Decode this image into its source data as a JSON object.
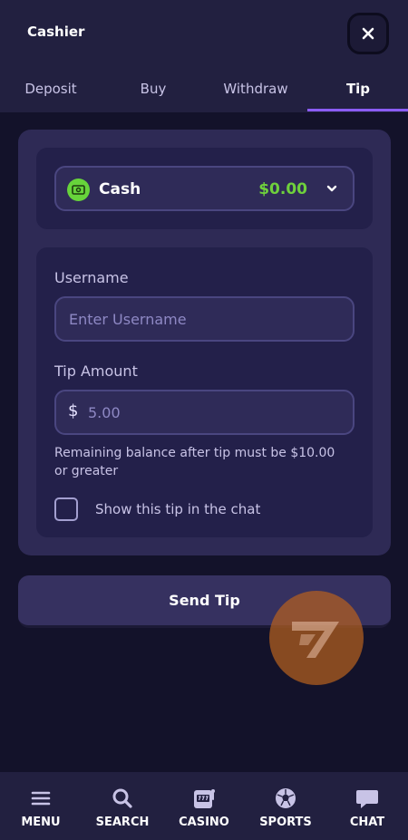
{
  "header": {
    "title": "Cashier"
  },
  "tabs": [
    {
      "label": "Deposit"
    },
    {
      "label": "Buy"
    },
    {
      "label": "Withdraw"
    },
    {
      "label": "Tip",
      "active": true
    }
  ],
  "wallet": {
    "currency": "Cash",
    "balance": "$0.00"
  },
  "form": {
    "username_label": "Username",
    "username_placeholder": "Enter Username",
    "amount_label": "Tip Amount",
    "currency_symbol": "$",
    "amount_placeholder": "5.00",
    "note": "Remaining balance after tip must be $10.00 or greater",
    "show_in_chat_label": "Show this tip in the chat",
    "show_in_chat_checked": false
  },
  "send_button": {
    "label": "Send Tip"
  },
  "bottom_nav": [
    {
      "label": "MENU",
      "icon": "menu-icon"
    },
    {
      "label": "SEARCH",
      "icon": "search-icon"
    },
    {
      "label": "CASINO",
      "icon": "slot-machine-icon"
    },
    {
      "label": "SPORTS",
      "icon": "soccer-ball-icon"
    },
    {
      "label": "CHAT",
      "icon": "chat-bubble-icon"
    }
  ],
  "colors": {
    "background": "#13122a",
    "panel": "#222040",
    "accent": "#8b5cf6",
    "balance_green": "#6fd13c"
  }
}
